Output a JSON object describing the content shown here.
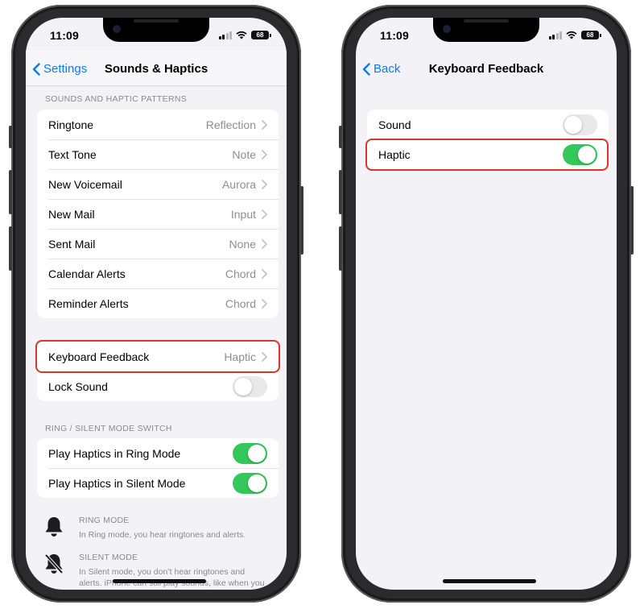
{
  "left_phone": {
    "status": {
      "time": "11:09",
      "battery": "68"
    },
    "nav": {
      "back_label": "Settings",
      "title": "Sounds & Haptics"
    },
    "patterns_header": "SOUNDS AND HAPTIC PATTERNS",
    "patterns": [
      {
        "label": "Ringtone",
        "value": "Reflection"
      },
      {
        "label": "Text Tone",
        "value": "Note"
      },
      {
        "label": "New Voicemail",
        "value": "Aurora"
      },
      {
        "label": "New Mail",
        "value": "Input"
      },
      {
        "label": "Sent Mail",
        "value": "None"
      },
      {
        "label": "Calendar Alerts",
        "value": "Chord"
      },
      {
        "label": "Reminder Alerts",
        "value": "Chord"
      }
    ],
    "keyboard_feedback": {
      "label": "Keyboard Feedback",
      "value": "Haptic"
    },
    "lock_sound": {
      "label": "Lock Sound",
      "on": false
    },
    "switch_header": "RING / SILENT MODE SWITCH",
    "ring_haptics": {
      "label": "Play Haptics in Ring Mode",
      "on": true
    },
    "silent_haptics": {
      "label": "Play Haptics in Silent Mode",
      "on": true
    },
    "ring_mode": {
      "title": "RING MODE",
      "desc": "In Ring mode, you hear ringtones and alerts."
    },
    "silent_mode": {
      "title": "SILENT MODE",
      "desc": "In Silent mode, you don’t hear ringtones and alerts. iPhone can still play sounds, like when you play music or videos."
    }
  },
  "right_phone": {
    "status": {
      "time": "11:09",
      "battery": "68"
    },
    "nav": {
      "back_label": "Back",
      "title": "Keyboard Feedback"
    },
    "sound": {
      "label": "Sound",
      "on": false
    },
    "haptic": {
      "label": "Haptic",
      "on": true
    }
  },
  "colors": {
    "accent": "#0a7aff",
    "toggle_on": "#34c759",
    "highlight": "#d0392b",
    "background": "#f2f2f7"
  }
}
